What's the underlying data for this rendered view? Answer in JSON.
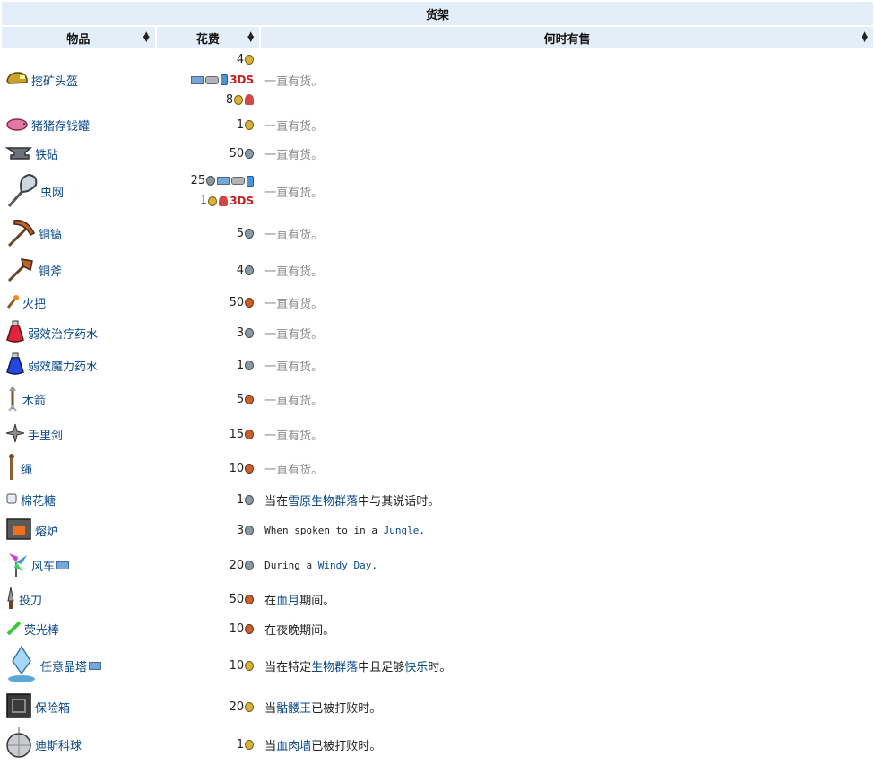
{
  "table": {
    "caption": "货架",
    "headers": {
      "item": "物品",
      "cost": "花费",
      "when": "何时有售"
    },
    "platform_3ds": "3DS",
    "rows": [
      {
        "icon": "mining-helmet-icon",
        "name": "挖矿头盔",
        "cost_lines": [
          {
            "amount": "4",
            "coin": "gold",
            "platforms": []
          },
          {
            "amount": "",
            "coin": "",
            "platforms": [
              "pc",
              "console",
              "mobile",
              "3ds"
            ]
          },
          {
            "amount": "8",
            "coin": "gold",
            "platforms": [
              "old-gen"
            ]
          }
        ],
        "when": "一直有货。",
        "when_style": "gray"
      },
      {
        "icon": "piggy-bank-icon",
        "name": "猪猪存钱罐",
        "cost_lines": [
          {
            "amount": "1",
            "coin": "gold"
          }
        ],
        "when": "一直有货。",
        "when_style": "gray"
      },
      {
        "icon": "iron-anvil-icon",
        "name": "铁砧",
        "cost_lines": [
          {
            "amount": "50",
            "coin": "silver"
          }
        ],
        "when": "一直有货。",
        "when_style": "gray"
      },
      {
        "icon": "bug-net-icon",
        "name": "虫网",
        "cost_lines": [
          {
            "amount": "25",
            "coin": "silver",
            "platforms": [
              "pc",
              "console",
              "mobile"
            ]
          },
          {
            "amount": "1",
            "coin": "gold",
            "platforms": [
              "old-gen",
              "3ds"
            ]
          }
        ],
        "when": "一直有货。",
        "when_style": "gray"
      },
      {
        "icon": "copper-pickaxe-icon",
        "name": "铜镐",
        "cost_lines": [
          {
            "amount": "5",
            "coin": "silver"
          }
        ],
        "when": "一直有货。",
        "when_style": "gray"
      },
      {
        "icon": "copper-axe-icon",
        "name": "铜斧",
        "cost_lines": [
          {
            "amount": "4",
            "coin": "silver"
          }
        ],
        "when": "一直有货。",
        "when_style": "gray"
      },
      {
        "icon": "torch-icon",
        "name": "火把",
        "cost_lines": [
          {
            "amount": "50",
            "coin": "copper"
          }
        ],
        "when": "一直有货。",
        "when_style": "gray"
      },
      {
        "icon": "lesser-healing-potion-icon",
        "name": "弱效治疗药水",
        "cost_lines": [
          {
            "amount": "3",
            "coin": "silver"
          }
        ],
        "when": "一直有货。",
        "when_style": "gray"
      },
      {
        "icon": "lesser-mana-potion-icon",
        "name": "弱效魔力药水",
        "cost_lines": [
          {
            "amount": "1",
            "coin": "silver"
          }
        ],
        "when": "一直有货。",
        "when_style": "gray"
      },
      {
        "icon": "wooden-arrow-icon",
        "name": "木箭",
        "cost_lines": [
          {
            "amount": "5",
            "coin": "copper"
          }
        ],
        "when": "一直有货。",
        "when_style": "gray"
      },
      {
        "icon": "shuriken-icon",
        "name": "手里剑",
        "cost_lines": [
          {
            "amount": "15",
            "coin": "copper"
          }
        ],
        "when": "一直有货。",
        "when_style": "gray"
      },
      {
        "icon": "rope-icon",
        "name": "绳",
        "cost_lines": [
          {
            "amount": "10",
            "coin": "copper"
          }
        ],
        "when": "一直有货。",
        "when_style": "gray"
      },
      {
        "icon": "marshmallow-icon",
        "name": "棉花糖",
        "cost_lines": [
          {
            "amount": "1",
            "coin": "silver"
          }
        ],
        "when_parts": [
          {
            "t": "当在"
          },
          {
            "t": "雪原生物群落",
            "link": true
          },
          {
            "t": "中与其说话时。"
          }
        ]
      },
      {
        "icon": "furnace-icon",
        "name": "熔炉",
        "cost_lines": [
          {
            "amount": "3",
            "coin": "silver"
          }
        ],
        "when_mono": true,
        "when_parts": [
          {
            "t": "When spoken to in a "
          },
          {
            "t": "Jungle",
            "link": true
          },
          {
            "t": "."
          }
        ]
      },
      {
        "icon": "pinwheel-icon",
        "name": "风车",
        "name_platforms": [
          "pc"
        ],
        "cost_lines": [
          {
            "amount": "20",
            "coin": "silver"
          }
        ],
        "when_mono": true,
        "when_parts": [
          {
            "t": "During a "
          },
          {
            "t": "Windy Day",
            "link": true
          },
          {
            "t": "."
          }
        ]
      },
      {
        "icon": "throwing-knife-icon",
        "name": "投刀",
        "cost_lines": [
          {
            "amount": "50",
            "coin": "copper"
          }
        ],
        "when_parts": [
          {
            "t": "在"
          },
          {
            "t": "血月",
            "link": true
          },
          {
            "t": "期间。"
          }
        ]
      },
      {
        "icon": "glowstick-icon",
        "name": "荧光棒",
        "cost_lines": [
          {
            "amount": "10",
            "coin": "copper"
          }
        ],
        "when_parts": [
          {
            "t": "在夜晚期间。"
          }
        ]
      },
      {
        "icon": "universal-pylon-icon",
        "name": "任意晶塔",
        "name_platforms": [
          "pc"
        ],
        "cost_lines": [
          {
            "amount": "10",
            "coin": "gold"
          }
        ],
        "when_parts": [
          {
            "t": "当在特定"
          },
          {
            "t": "生物群落",
            "link": true
          },
          {
            "t": "中且足够"
          },
          {
            "t": "快乐",
            "link": true
          },
          {
            "t": "时。"
          }
        ]
      },
      {
        "icon": "safe-icon",
        "name": "保险箱",
        "cost_lines": [
          {
            "amount": "20",
            "coin": "gold"
          }
        ],
        "when_parts": [
          {
            "t": "当"
          },
          {
            "t": "骷髅王",
            "link": true
          },
          {
            "t": "已被打败时。"
          }
        ]
      },
      {
        "icon": "disco-ball-icon",
        "name": "迪斯科球",
        "cost_lines": [
          {
            "amount": "1",
            "coin": "gold"
          }
        ],
        "when_parts": [
          {
            "t": "当"
          },
          {
            "t": "血肉墙",
            "link": true
          },
          {
            "t": "已被打败时。"
          }
        ]
      }
    ]
  },
  "colors": {
    "header_bg": "#e3eef8",
    "link": "#0b4a8c",
    "muted": "#8a8a8a",
    "gold": "#d9b23a",
    "silver": "#8c9aa3",
    "copper": "#c8612e"
  }
}
